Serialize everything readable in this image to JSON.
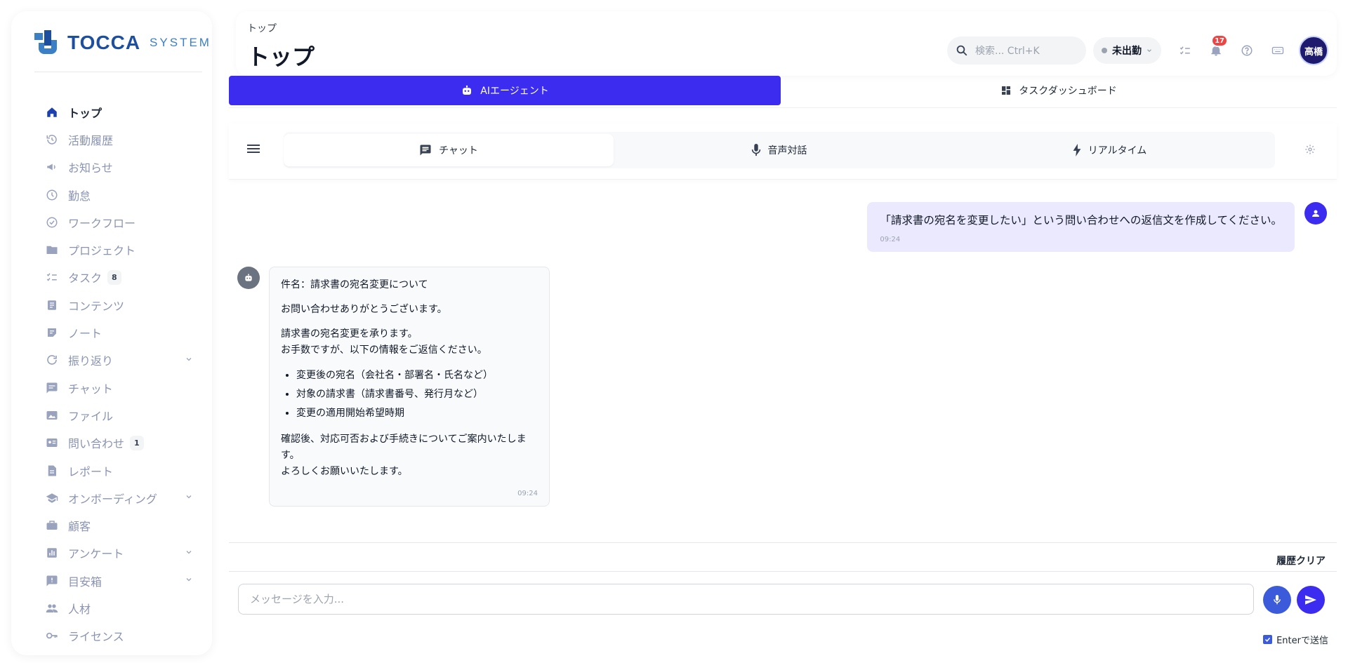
{
  "brand": {
    "name": "TOCCA",
    "sub": "SYSTEMS",
    "colors": {
      "primary": "#3b2cf0",
      "brand_blue": "#1d4fa0"
    }
  },
  "sidebar": {
    "items": [
      {
        "label": "トップ",
        "icon": "home-icon",
        "active": true
      },
      {
        "label": "活動履歴",
        "icon": "history-icon"
      },
      {
        "label": "お知らせ",
        "icon": "megaphone-icon"
      },
      {
        "label": "勤怠",
        "icon": "clock-icon"
      },
      {
        "label": "ワークフロー",
        "icon": "check-circle-icon"
      },
      {
        "label": "プロジェクト",
        "icon": "folder-icon"
      },
      {
        "label": "タスク",
        "icon": "checklist-icon",
        "badge": "8"
      },
      {
        "label": "コンテンツ",
        "icon": "document-icon"
      },
      {
        "label": "ノート",
        "icon": "note-icon"
      },
      {
        "label": "振り返り",
        "icon": "refresh-icon",
        "expandable": true
      },
      {
        "label": "チャット",
        "icon": "chat-icon"
      },
      {
        "label": "ファイル",
        "icon": "image-icon"
      },
      {
        "label": "問い合わせ",
        "icon": "contact-card-icon",
        "badge": "1"
      },
      {
        "label": "レポート",
        "icon": "report-icon"
      },
      {
        "label": "オンボーディング",
        "icon": "school-icon",
        "expandable": true
      },
      {
        "label": "顧客",
        "icon": "briefcase-icon"
      },
      {
        "label": "アンケート",
        "icon": "bar-chart-icon",
        "expandable": true
      },
      {
        "label": "目安箱",
        "icon": "feedback-icon",
        "expandable": true
      },
      {
        "label": "人材",
        "icon": "people-icon"
      },
      {
        "label": "ライセンス",
        "icon": "key-icon"
      },
      {
        "label": "AIエージェント",
        "icon": "robot-icon"
      }
    ]
  },
  "header": {
    "breadcrumb": "トップ",
    "title": "トップ",
    "search_placeholder": "検索... Ctrl+K",
    "status": "未出勤",
    "notification_count": "17",
    "user_initials": "高橋"
  },
  "main_tabs": [
    {
      "label": "AIエージェント",
      "icon": "robot-icon",
      "active": true
    },
    {
      "label": "タスクダッシュボード",
      "icon": "dashboard-icon",
      "active": false
    }
  ],
  "sub_tabs": [
    {
      "label": "チャット",
      "icon": "chat-icon",
      "active": true
    },
    {
      "label": "音声対話",
      "icon": "mic-icon",
      "active": false
    },
    {
      "label": "リアルタイム",
      "icon": "bolt-icon",
      "active": false
    }
  ],
  "chat": {
    "user_message": {
      "text": "「請求書の宛名を変更したい」という問い合わせへの返信文を作成してください。",
      "time": "09:24"
    },
    "bot_message": {
      "subject": "件名：請求書の宛名変更について",
      "greeting": "お問い合わせありがとうございます。",
      "body_line1": "請求書の宛名変更を承ります。",
      "body_line2": "お手数ですが、以下の情報をご返信ください。",
      "bullets": [
        "変更後の宛名（会社名・部署名・氏名など）",
        "対象の請求書（請求書番号、発行月など）",
        "変更の適用開始希望時期"
      ],
      "closing_line1": "確認後、対応可否および手続きについてご案内いたします。",
      "closing_line2": "よろしくお願いいたします。",
      "time": "09:24"
    }
  },
  "input": {
    "clear_label": "履歴クリア",
    "placeholder": "メッセージを入力...",
    "enter_to_send_label": "Enterで送信",
    "enter_to_send_checked": true
  }
}
